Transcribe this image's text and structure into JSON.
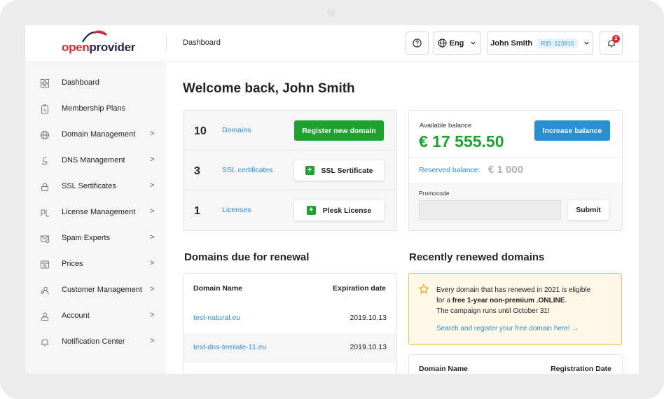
{
  "header": {
    "logo_part1": "open",
    "logo_part2": "provider",
    "page_title": "Dashboard",
    "language": "Eng",
    "user_name": "John Smith",
    "rid": "RID: 123915",
    "notification_count": "2"
  },
  "sidebar": {
    "items": [
      {
        "label": "Dashboard",
        "icon": "grid-icon",
        "chevron": ""
      },
      {
        "label": "Membership Plans",
        "icon": "membership-icon",
        "chevron": ""
      },
      {
        "label": "Domain Management",
        "icon": "globe-icon",
        "chevron": ">"
      },
      {
        "label": "DNS Management",
        "icon": "dns-icon",
        "chevron": ">"
      },
      {
        "label": "SSL Sertificates",
        "icon": "lock-icon",
        "chevron": ">"
      },
      {
        "label": "License Management",
        "icon": "license-icon",
        "chevron": ">"
      },
      {
        "label": "Spam Experts",
        "icon": "spam-mail-icon",
        "chevron": ">"
      },
      {
        "label": "Prices",
        "icon": "prices-icon",
        "chevron": ">"
      },
      {
        "label": "Customer Management",
        "icon": "customers-icon",
        "chevron": ">"
      },
      {
        "label": "Account",
        "icon": "account-icon",
        "chevron": ">"
      },
      {
        "label": "Notification Center",
        "icon": "bell-icon",
        "chevron": ">"
      }
    ]
  },
  "main": {
    "welcome": "Welcome back, John Smith",
    "stats": [
      {
        "count": "10",
        "label": "Domains",
        "button": "Register new domain"
      },
      {
        "count": "3",
        "label": "SSL certificates",
        "button": "SSL Sertificate"
      },
      {
        "count": "1",
        "label": "Licenses",
        "button": "Plesk License"
      }
    ],
    "balance": {
      "label": "Available balance",
      "amount": "€ 17 555.50",
      "increase_button": "Increase balance",
      "reserved_label": "Reserved balance:",
      "reserved_amount": "€ 1 000",
      "promocode_label": "Promocode",
      "promocode_value": "",
      "submit_button": "Submit"
    },
    "renewal": {
      "title": "Domains due for renewal",
      "col_name": "Domain Name",
      "col_date": "Expiration date",
      "rows": [
        {
          "name": "test-natural.eu",
          "date": "2019.10.13"
        },
        {
          "name": "test-dns-temlate-11.eu",
          "date": "2019.10.13"
        }
      ]
    },
    "recent": {
      "title": "Recently renewed domains",
      "promo_line1": "Every domain that has renewed in 2021 is eligible",
      "promo_line2_pre": "for a ",
      "promo_line2_bold": "free 1-year non-premium .ONLINE",
      "promo_line2_post": ".",
      "promo_line3": "The campaign runs until October 31!",
      "promo_link": "Search and register your free domain here! →",
      "col_name": "Domain Name",
      "col_date": "Registration Date"
    }
  },
  "colors": {
    "accent_green": "#1fa12f",
    "accent_blue": "#2a8fd0",
    "brand_red": "#e3262f",
    "promo_border": "#f2c25a"
  }
}
